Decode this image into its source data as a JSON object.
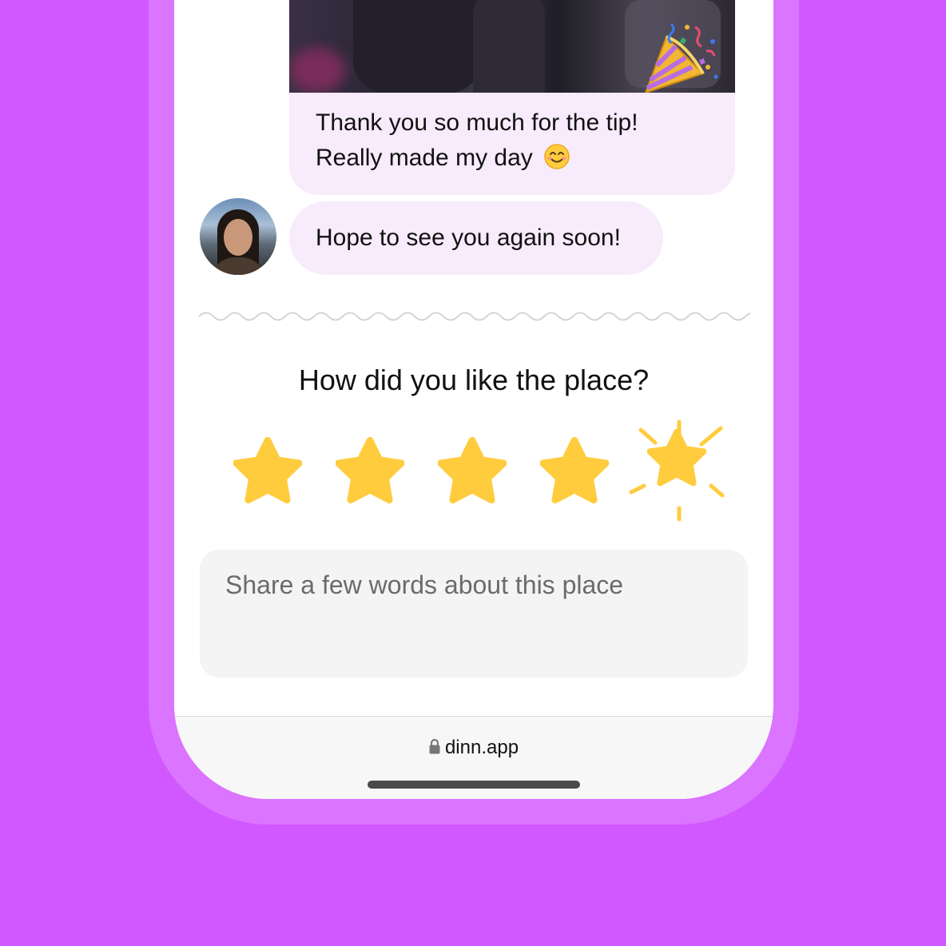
{
  "colors": {
    "background": "#D158FF",
    "phone_frame": "#DB74FF",
    "bubble": "#F7EBFC",
    "star": "#FFCC3D",
    "input_bg": "#F4F4F4"
  },
  "chat": {
    "media_icon": "party-popper-icon",
    "messages": [
      {
        "lines": [
          "Thank you so much for the tip!",
          "Really made my day"
        ],
        "emoji": "smiling-face-icon"
      },
      {
        "lines": [
          "Hope to see you again soon!"
        ]
      }
    ]
  },
  "rating": {
    "question": "How did you like the place?",
    "value": 5,
    "max": 5,
    "selected_highlight": "sparkle"
  },
  "review": {
    "placeholder": "Share a few words about this place",
    "value": ""
  },
  "browser": {
    "url": "dinn.app",
    "lock_icon": "lock-icon"
  }
}
